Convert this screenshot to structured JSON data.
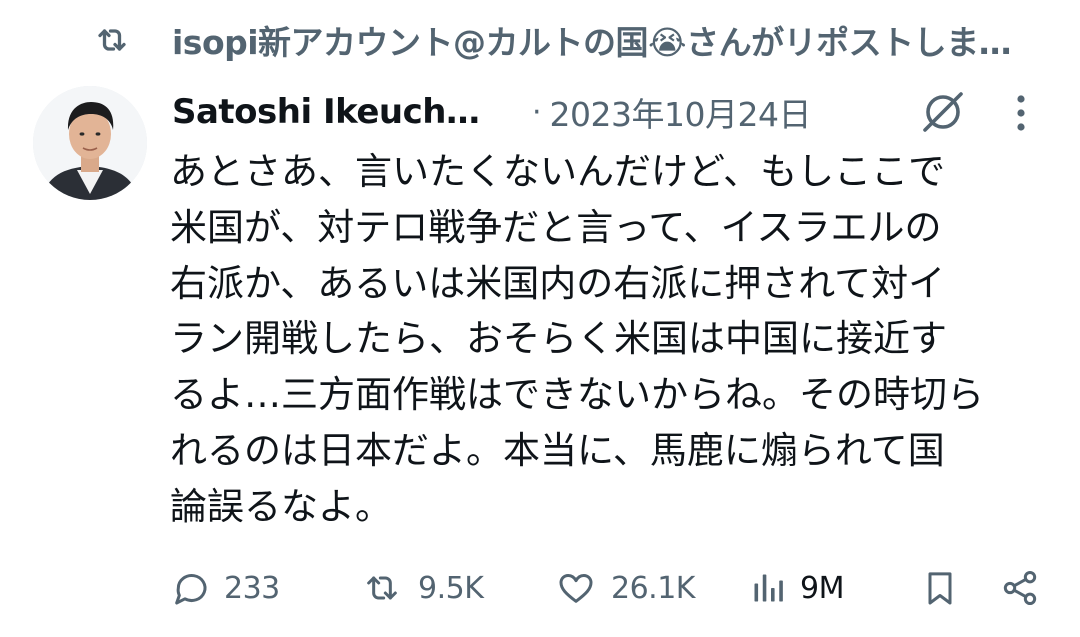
{
  "repost_banner": {
    "icon": "repost-icon",
    "text": "isopi新アカウント@カルトの国😭さんがリポストしま…"
  },
  "post": {
    "author_name": "Satoshi Ikeuch…",
    "separator": "·",
    "date": "2023年10月24日",
    "avatar_icon": "avatar",
    "header_icons": [
      "grok-icon",
      "more-vertical-icon"
    ],
    "body_lines": [
      "あとさあ、言いたくないんだけど、もしここで",
      "米国が、対テロ戦争だと言って、イスラエルの",
      "右派か、あるいは米国内の右派に押されて対イ",
      "ラン開戦したら、おそらく米国は中国に接近す",
      "るよ…三方面作戦はできないからね。その時切ら",
      "れるのは日本だよ。本当に、馬鹿に煽られて国",
      "論誤るなよ。"
    ]
  },
  "actions": {
    "replies": {
      "icon": "reply-icon",
      "count": "233"
    },
    "reposts": {
      "icon": "repost-icon",
      "count": "9.5K"
    },
    "likes": {
      "icon": "heart-icon",
      "count": "26.1K"
    },
    "views": {
      "icon": "views-icon",
      "count": "9M"
    },
    "bookmark": {
      "icon": "bookmark-icon"
    },
    "share": {
      "icon": "share-icon"
    }
  },
  "colors": {
    "text": "#0f1419",
    "secondary": "#536471",
    "background": "#ffffff"
  }
}
